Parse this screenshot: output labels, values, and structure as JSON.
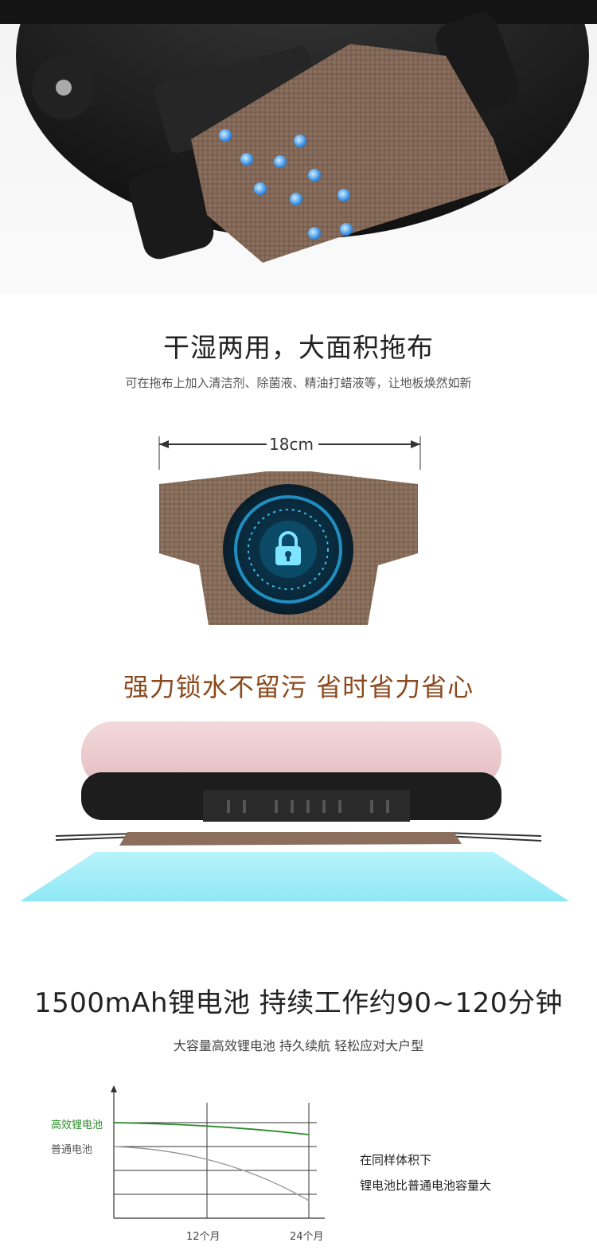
{
  "section1": {
    "title": "干湿两用，大面积拖布",
    "subtitle": "可在拖布上加入清洁剂、除菌液、精油打蜡液等，让地板焕然如新"
  },
  "pad": {
    "dimension_label": "18cm",
    "lock_icon": "lock-icon"
  },
  "slogan": "强力锁水不留污  省时省力省心",
  "section2": {
    "title": "1500mAh锂电池 持续工作约90~120分钟",
    "subtitle": "大容量高效锂电池  持久续航  轻松应对大户型"
  },
  "chart_data": {
    "type": "line",
    "x_ticks": [
      "12个月",
      "24个月"
    ],
    "series": [
      {
        "name": "高效锂电池",
        "color": "#2a8a2a"
      },
      {
        "name": "普通电池",
        "color": "#9a9a9a"
      }
    ],
    "note_lines": [
      "在同样体积下",
      "锂电池比普通电池容量大"
    ]
  },
  "colors": {
    "slogan": "#8a4a1e",
    "mop": "#8b6e5c",
    "lithium": "#2a8a2a",
    "normal": "#9a9a9a",
    "floor_glow": "#8fe8f5"
  }
}
